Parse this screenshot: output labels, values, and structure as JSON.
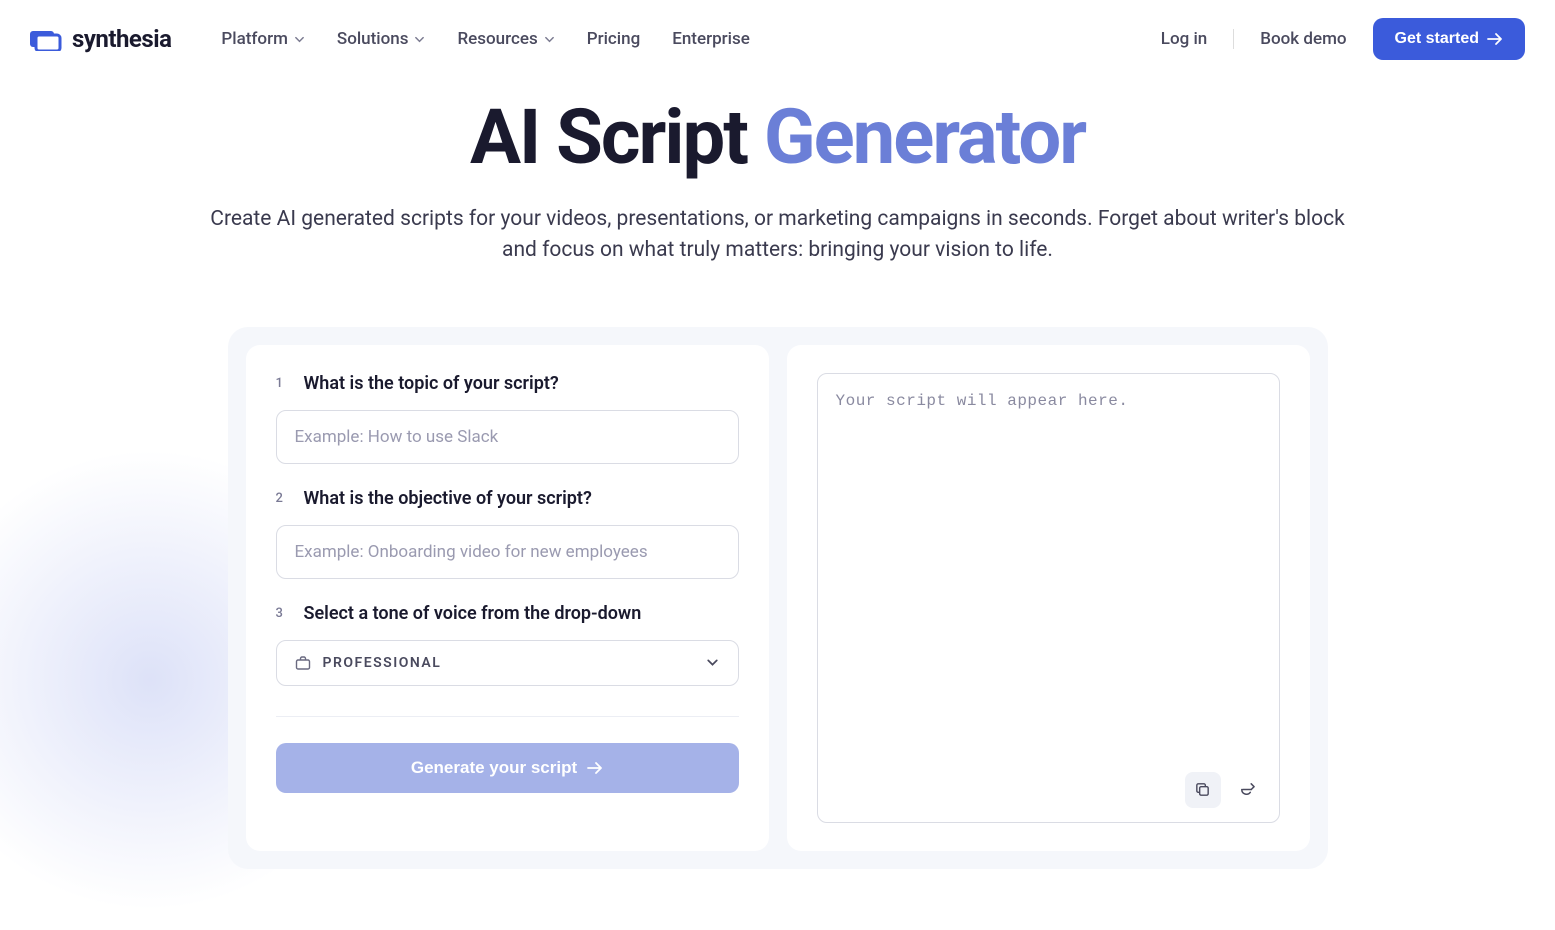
{
  "brand": {
    "name": "synthesia"
  },
  "nav": {
    "items": [
      {
        "label": "Platform",
        "dropdown": true
      },
      {
        "label": "Solutions",
        "dropdown": true
      },
      {
        "label": "Resources",
        "dropdown": true
      },
      {
        "label": "Pricing",
        "dropdown": false
      },
      {
        "label": "Enterprise",
        "dropdown": false
      }
    ],
    "login": "Log in",
    "book_demo": "Book demo",
    "get_started": "Get started"
  },
  "hero": {
    "title_main": "AI Script ",
    "title_accent": "Generator",
    "subtitle": "Create AI generated scripts for your videos, presentations, or marketing campaigns in seconds. Forget about writer's block and focus on what truly matters: bringing your vision to life."
  },
  "form": {
    "q1": {
      "num": "1",
      "label": "What is the topic of your script?",
      "placeholder": "Example: How to use Slack",
      "value": ""
    },
    "q2": {
      "num": "2",
      "label": "What is the objective of your script?",
      "placeholder": "Example: Onboarding video for new employees",
      "value": ""
    },
    "q3": {
      "num": "3",
      "label": "Select a tone of voice from the drop-down",
      "selected": "PROFESSIONAL"
    },
    "generate_label": "Generate your script"
  },
  "output": {
    "placeholder": "Your script will appear here."
  }
}
